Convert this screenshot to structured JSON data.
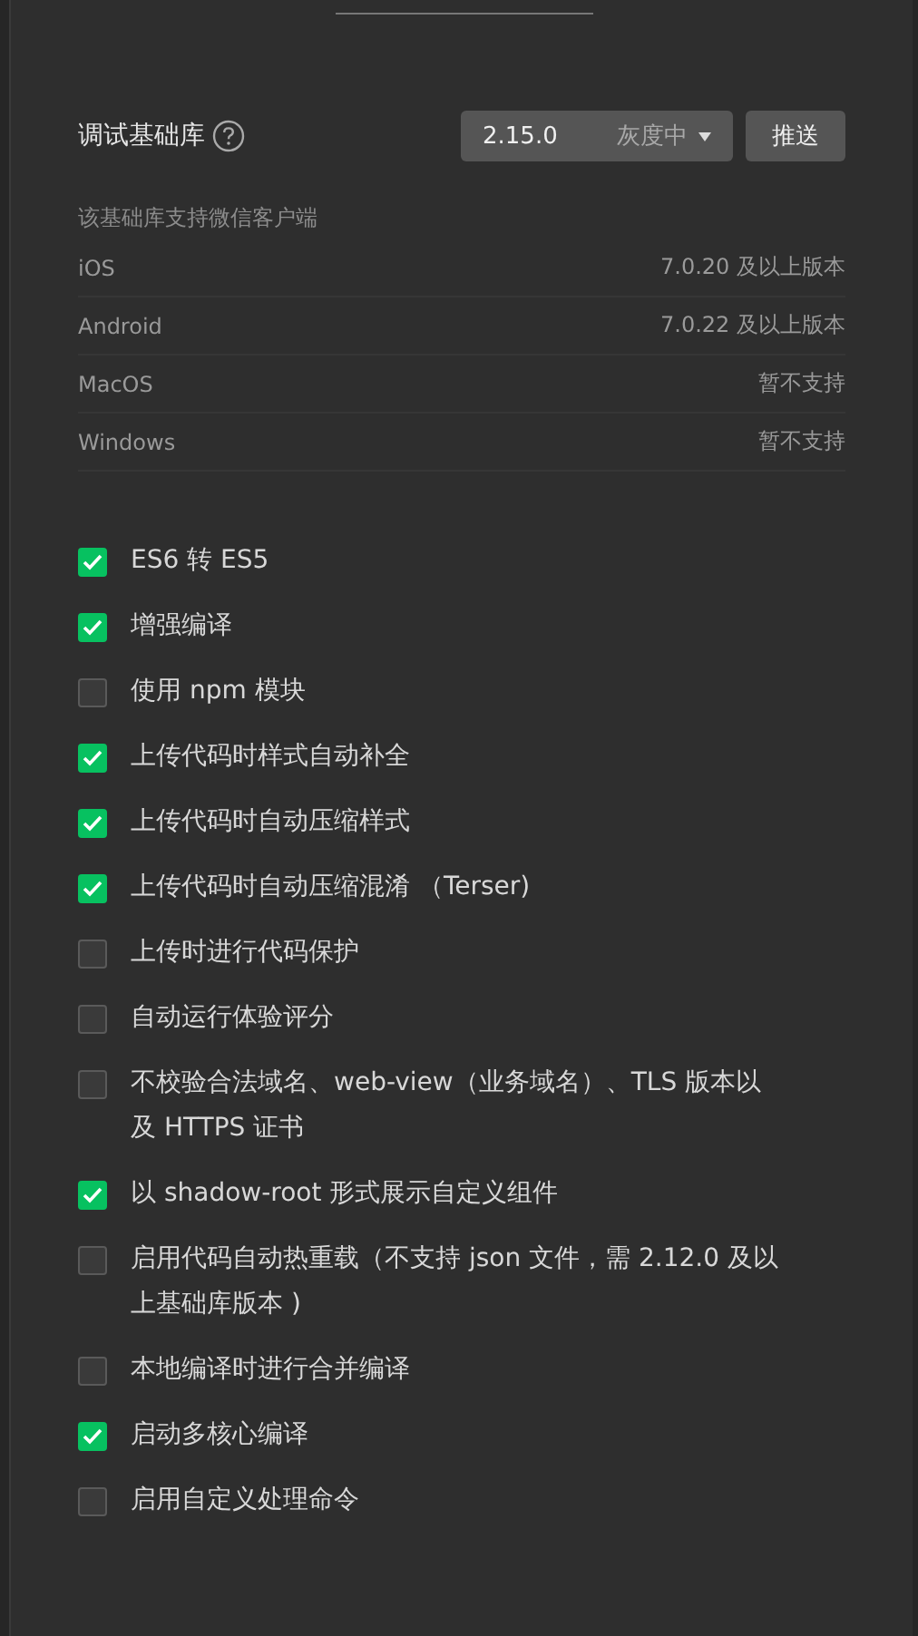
{
  "library": {
    "label": "调试基础库",
    "version": "2.15.0",
    "status": "灰度中",
    "push_button": "推送"
  },
  "support": {
    "caption": "该基础库支持微信客户端",
    "rows": [
      {
        "platform": "iOS",
        "requirement": "7.0.20 及以上版本"
      },
      {
        "platform": "Android",
        "requirement": "7.0.22 及以上版本"
      },
      {
        "platform": "MacOS",
        "requirement": "暂不支持"
      },
      {
        "platform": "Windows",
        "requirement": "暂不支持"
      }
    ]
  },
  "options": [
    {
      "label": "ES6 转 ES5",
      "checked": true
    },
    {
      "label": "增强编译",
      "checked": true
    },
    {
      "label": "使用 npm 模块",
      "checked": false
    },
    {
      "label": "上传代码时样式自动补全",
      "checked": true
    },
    {
      "label": "上传代码时自动压缩样式",
      "checked": true
    },
    {
      "label": "上传代码时自动压缩混淆 （Terser)",
      "checked": true
    },
    {
      "label": "上传时进行代码保护",
      "checked": false
    },
    {
      "label": "自动运行体验评分",
      "checked": false
    },
    {
      "label": "不校验合法域名、web-view（业务域名）、TLS 版本以及 HTTPS 证书",
      "checked": false
    },
    {
      "label": "以 shadow-root 形式展示自定义组件",
      "checked": true
    },
    {
      "label": "启用代码自动热重载（不支持 json 文件，需 2.12.0 及以上基础库版本 )",
      "checked": false
    },
    {
      "label": "本地编译时进行合并编译",
      "checked": false
    },
    {
      "label": "启动多核心编译",
      "checked": true
    },
    {
      "label": "启用自定义处理命令",
      "checked": false
    }
  ]
}
